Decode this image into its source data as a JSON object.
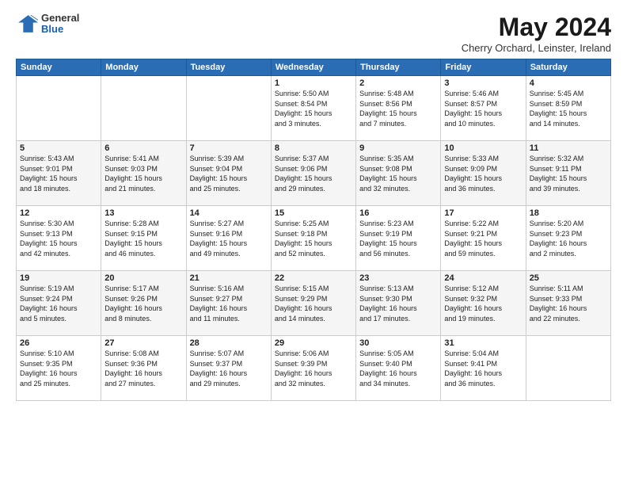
{
  "logo": {
    "general": "General",
    "blue": "Blue"
  },
  "title": "May 2024",
  "subtitle": "Cherry Orchard, Leinster, Ireland",
  "days_of_week": [
    "Sunday",
    "Monday",
    "Tuesday",
    "Wednesday",
    "Thursday",
    "Friday",
    "Saturday"
  ],
  "weeks": [
    [
      {
        "num": "",
        "info": ""
      },
      {
        "num": "",
        "info": ""
      },
      {
        "num": "",
        "info": ""
      },
      {
        "num": "1",
        "info": "Sunrise: 5:50 AM\nSunset: 8:54 PM\nDaylight: 15 hours\nand 3 minutes."
      },
      {
        "num": "2",
        "info": "Sunrise: 5:48 AM\nSunset: 8:56 PM\nDaylight: 15 hours\nand 7 minutes."
      },
      {
        "num": "3",
        "info": "Sunrise: 5:46 AM\nSunset: 8:57 PM\nDaylight: 15 hours\nand 10 minutes."
      },
      {
        "num": "4",
        "info": "Sunrise: 5:45 AM\nSunset: 8:59 PM\nDaylight: 15 hours\nand 14 minutes."
      }
    ],
    [
      {
        "num": "5",
        "info": "Sunrise: 5:43 AM\nSunset: 9:01 PM\nDaylight: 15 hours\nand 18 minutes."
      },
      {
        "num": "6",
        "info": "Sunrise: 5:41 AM\nSunset: 9:03 PM\nDaylight: 15 hours\nand 21 minutes."
      },
      {
        "num": "7",
        "info": "Sunrise: 5:39 AM\nSunset: 9:04 PM\nDaylight: 15 hours\nand 25 minutes."
      },
      {
        "num": "8",
        "info": "Sunrise: 5:37 AM\nSunset: 9:06 PM\nDaylight: 15 hours\nand 29 minutes."
      },
      {
        "num": "9",
        "info": "Sunrise: 5:35 AM\nSunset: 9:08 PM\nDaylight: 15 hours\nand 32 minutes."
      },
      {
        "num": "10",
        "info": "Sunrise: 5:33 AM\nSunset: 9:09 PM\nDaylight: 15 hours\nand 36 minutes."
      },
      {
        "num": "11",
        "info": "Sunrise: 5:32 AM\nSunset: 9:11 PM\nDaylight: 15 hours\nand 39 minutes."
      }
    ],
    [
      {
        "num": "12",
        "info": "Sunrise: 5:30 AM\nSunset: 9:13 PM\nDaylight: 15 hours\nand 42 minutes."
      },
      {
        "num": "13",
        "info": "Sunrise: 5:28 AM\nSunset: 9:15 PM\nDaylight: 15 hours\nand 46 minutes."
      },
      {
        "num": "14",
        "info": "Sunrise: 5:27 AM\nSunset: 9:16 PM\nDaylight: 15 hours\nand 49 minutes."
      },
      {
        "num": "15",
        "info": "Sunrise: 5:25 AM\nSunset: 9:18 PM\nDaylight: 15 hours\nand 52 minutes."
      },
      {
        "num": "16",
        "info": "Sunrise: 5:23 AM\nSunset: 9:19 PM\nDaylight: 15 hours\nand 56 minutes."
      },
      {
        "num": "17",
        "info": "Sunrise: 5:22 AM\nSunset: 9:21 PM\nDaylight: 15 hours\nand 59 minutes."
      },
      {
        "num": "18",
        "info": "Sunrise: 5:20 AM\nSunset: 9:23 PM\nDaylight: 16 hours\nand 2 minutes."
      }
    ],
    [
      {
        "num": "19",
        "info": "Sunrise: 5:19 AM\nSunset: 9:24 PM\nDaylight: 16 hours\nand 5 minutes."
      },
      {
        "num": "20",
        "info": "Sunrise: 5:17 AM\nSunset: 9:26 PM\nDaylight: 16 hours\nand 8 minutes."
      },
      {
        "num": "21",
        "info": "Sunrise: 5:16 AM\nSunset: 9:27 PM\nDaylight: 16 hours\nand 11 minutes."
      },
      {
        "num": "22",
        "info": "Sunrise: 5:15 AM\nSunset: 9:29 PM\nDaylight: 16 hours\nand 14 minutes."
      },
      {
        "num": "23",
        "info": "Sunrise: 5:13 AM\nSunset: 9:30 PM\nDaylight: 16 hours\nand 17 minutes."
      },
      {
        "num": "24",
        "info": "Sunrise: 5:12 AM\nSunset: 9:32 PM\nDaylight: 16 hours\nand 19 minutes."
      },
      {
        "num": "25",
        "info": "Sunrise: 5:11 AM\nSunset: 9:33 PM\nDaylight: 16 hours\nand 22 minutes."
      }
    ],
    [
      {
        "num": "26",
        "info": "Sunrise: 5:10 AM\nSunset: 9:35 PM\nDaylight: 16 hours\nand 25 minutes."
      },
      {
        "num": "27",
        "info": "Sunrise: 5:08 AM\nSunset: 9:36 PM\nDaylight: 16 hours\nand 27 minutes."
      },
      {
        "num": "28",
        "info": "Sunrise: 5:07 AM\nSunset: 9:37 PM\nDaylight: 16 hours\nand 29 minutes."
      },
      {
        "num": "29",
        "info": "Sunrise: 5:06 AM\nSunset: 9:39 PM\nDaylight: 16 hours\nand 32 minutes."
      },
      {
        "num": "30",
        "info": "Sunrise: 5:05 AM\nSunset: 9:40 PM\nDaylight: 16 hours\nand 34 minutes."
      },
      {
        "num": "31",
        "info": "Sunrise: 5:04 AM\nSunset: 9:41 PM\nDaylight: 16 hours\nand 36 minutes."
      },
      {
        "num": "",
        "info": ""
      }
    ]
  ]
}
